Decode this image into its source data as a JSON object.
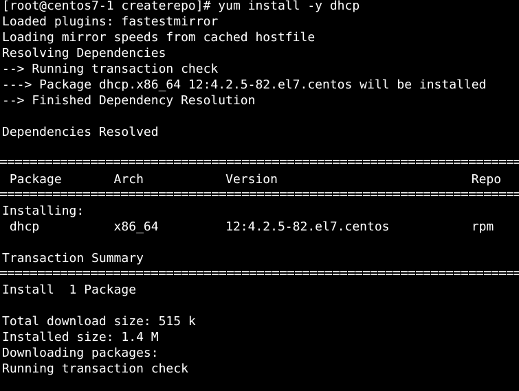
{
  "terminal": {
    "lines": [
      "[root@centos7-1 createrepo]# yum install -y dhcp",
      "Loaded plugins: fastestmirror",
      "Loading mirror speeds from cached hostfile",
      "Resolving Dependencies",
      "--> Running transaction check",
      "---> Package dhcp.x86_64 12:4.2.5-82.el7.centos will be installed",
      "--> Finished Dependency Resolution",
      "Dependencies Resolved",
      " Package       Arch           Version                          Repo",
      "Installing:",
      " dhcp          x86_64         12:4.2.5-82.el7.centos           rpm",
      "Transaction Summary",
      "Install  1 Package",
      "Total download size: 515 k",
      "Installed size: 1.4 M",
      "Downloading packages:",
      "Running transaction check"
    ]
  }
}
